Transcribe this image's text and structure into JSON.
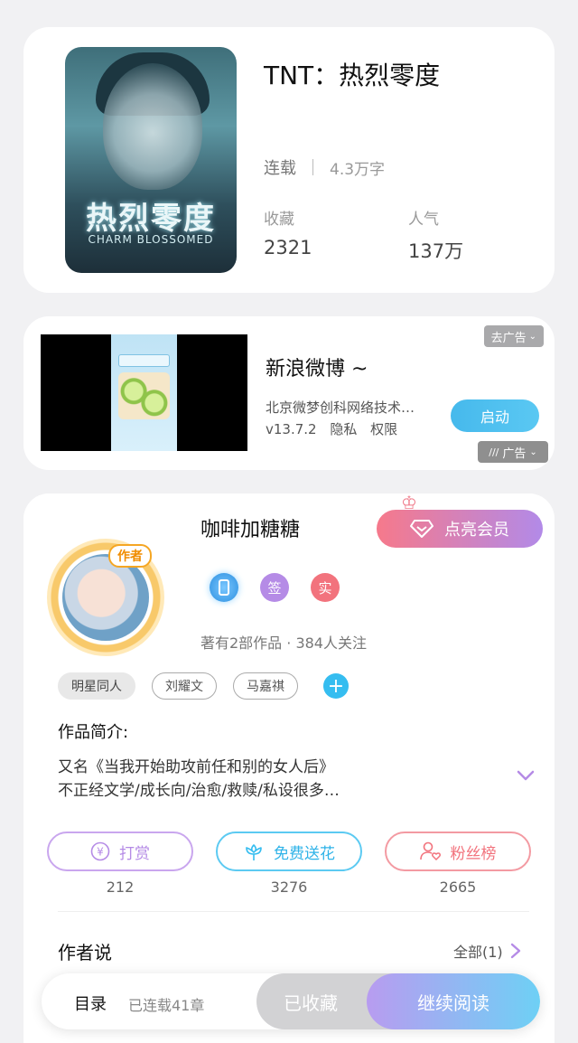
{
  "book": {
    "title": "TNT：热烈零度",
    "cover_title": "热烈零度",
    "cover_subtitle": "CHARM BLOSSOMED",
    "status": "连载",
    "word_count": "4.3万字",
    "favorites_label": "收藏",
    "favorites_value": "2321",
    "popularity_label": "人气",
    "popularity_value": "137万"
  },
  "ad": {
    "remove_ad_label": "去广告",
    "app_name": "新浪微博 ~",
    "company": "北京微梦创科网络技术…",
    "version": "v13.7.2",
    "privacy": "隐私",
    "permissions": "权限",
    "start_label": "启动",
    "ad_mark": "广告"
  },
  "author": {
    "avatar_badge": "作者",
    "name": "咖啡加糖糖",
    "vip_label": "点亮会员",
    "badge_sign": "签",
    "badge_real": "实",
    "works_summary": "著有2部作品 · 384人关注",
    "tags": [
      "明星同人",
      "刘耀文",
      "马嘉祺"
    ],
    "add_tag": "+"
  },
  "intro": {
    "heading": "作品简介:",
    "line1": "又名《当我开始助攻前任和别的女人后》",
    "line2": "不正经文学/成长向/治愈/救赎/私设很多…"
  },
  "actions": [
    {
      "label": "打赏",
      "count": "212",
      "color": "#b58be6"
    },
    {
      "label": "免费送花",
      "count": "3276",
      "color": "#35bdf0"
    },
    {
      "label": "粉丝榜",
      "count": "2665",
      "color": "#f2737d"
    }
  ],
  "author_says": {
    "heading": "作者说",
    "all_label": "全部(1)"
  },
  "bottom_bar": {
    "toc_label": "目录",
    "toc_status": "已连载41章",
    "collected_label": "已收藏",
    "continue_label": "继续阅读"
  }
}
